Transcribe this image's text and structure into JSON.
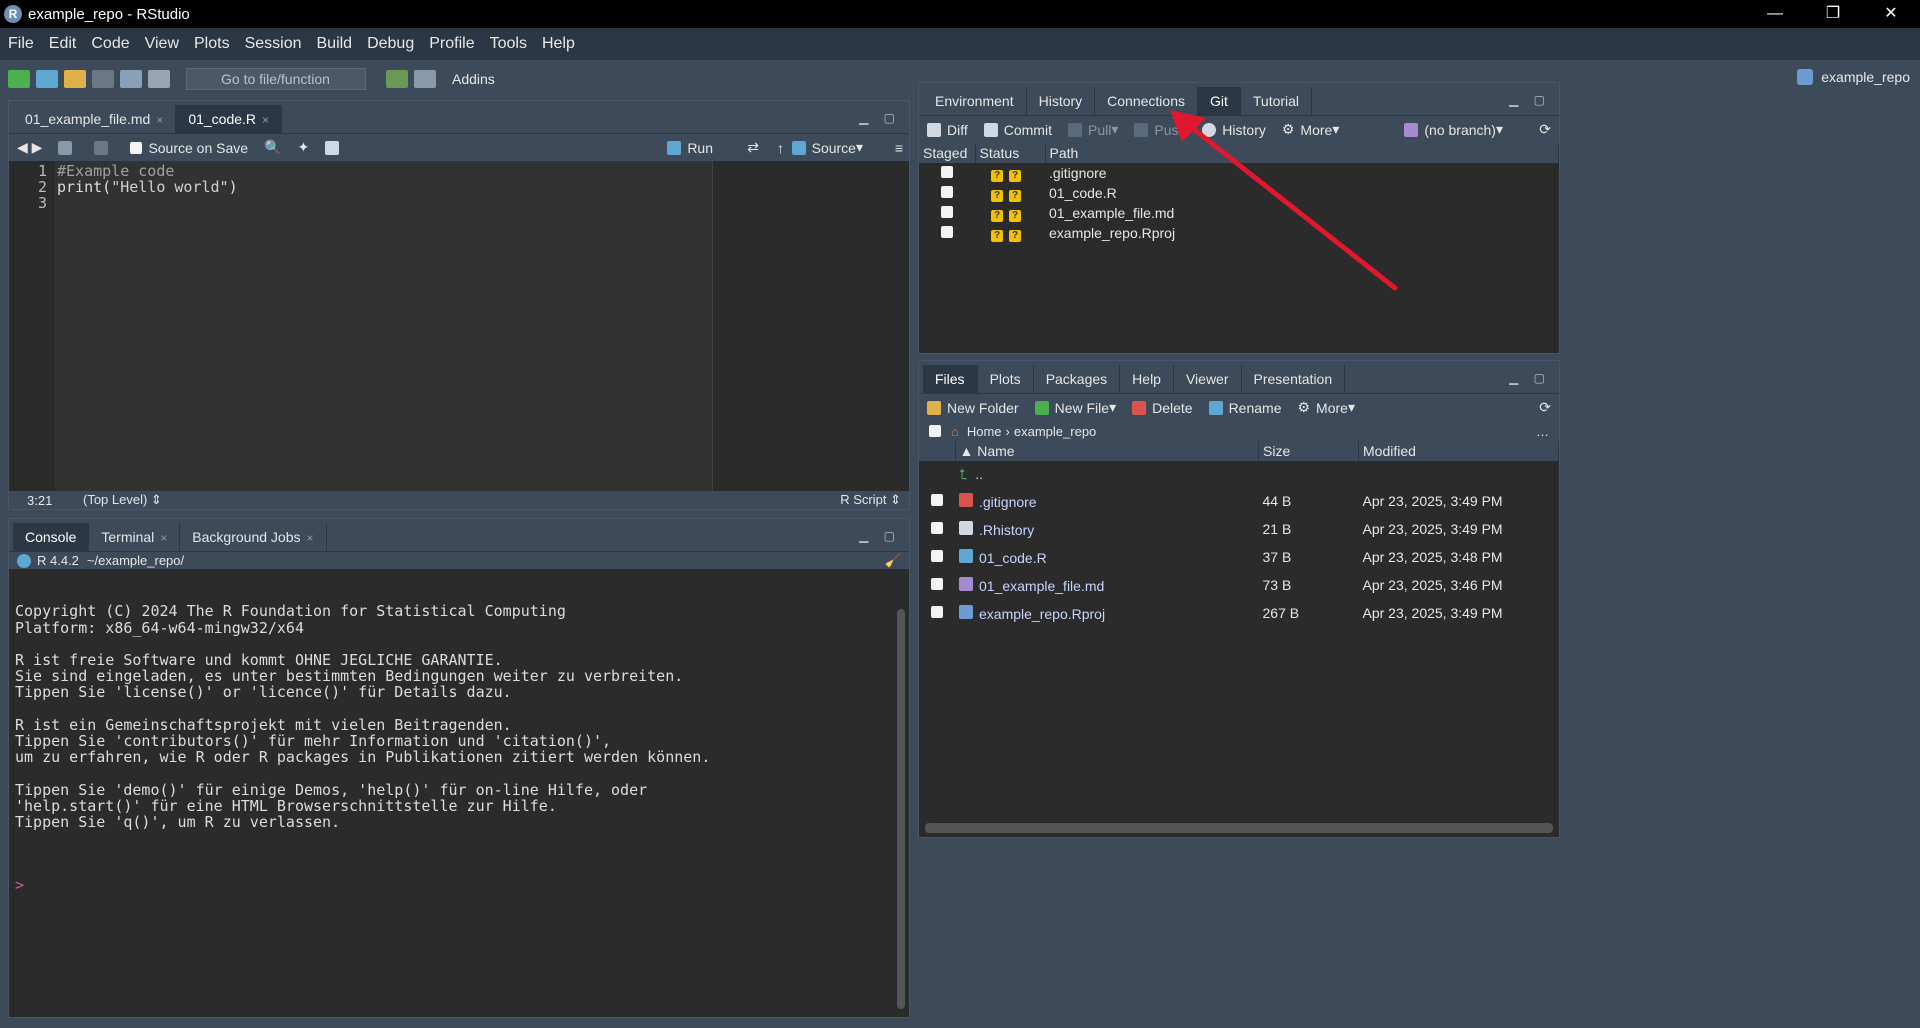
{
  "window": {
    "title": "example_repo - RStudio",
    "controls": [
      "—",
      "❐",
      "✕"
    ]
  },
  "menu": [
    "File",
    "Edit",
    "Code",
    "View",
    "Plots",
    "Session",
    "Build",
    "Debug",
    "Profile",
    "Tools",
    "Help"
  ],
  "toolbar": {
    "goto_placeholder": "Go to file/function",
    "addins": "Addins",
    "project": "example_repo"
  },
  "editor": {
    "tabs": [
      {
        "label": "01_example_file.md",
        "close": "×"
      },
      {
        "label": "01_code.R",
        "close": "×"
      }
    ],
    "source_on_save": "Source on Save",
    "run": "Run",
    "source": "Source",
    "lines": [
      "1",
      "2",
      "3"
    ],
    "code": {
      "line1": "",
      "line2": "#Example code",
      "line3_fn": "print",
      "line3_open": "(",
      "line3_str": "\"Hello world\"",
      "line3_close": ")"
    },
    "status": {
      "position": "3:21",
      "scope": "(Top Level)",
      "filetype": "R Script"
    }
  },
  "console": {
    "tabs": [
      {
        "label": "Console",
        "close": ""
      },
      {
        "label": "Terminal",
        "close": "×"
      },
      {
        "label": "Background Jobs",
        "close": "×"
      }
    ],
    "r_version": "R 4.4.2",
    "wd": "~/example_repo/",
    "output": "Copyright (C) 2024 The R Foundation for Statistical Computing\nPlatform: x86_64-w64-mingw32/x64\n\nR ist freie Software und kommt OHNE JEGLICHE GARANTIE.\nSie sind eingeladen, es unter bestimmten Bedingungen weiter zu verbreiten.\nTippen Sie 'license()' or 'licence()' für Details dazu.\n\nR ist ein Gemeinschaftsprojekt mit vielen Beitragenden.\nTippen Sie 'contributors()' für mehr Information und 'citation()',\num zu erfahren, wie R oder R packages in Publikationen zitiert werden können.\n\nTippen Sie 'demo()' für einige Demos, 'help()' für on-line Hilfe, oder\n'help.start()' für eine HTML Browserschnittstelle zur Hilfe.\nTippen Sie 'q()', um R zu verlassen.",
    "prompt": ">"
  },
  "git": {
    "tabs": [
      "Environment",
      "History",
      "Connections",
      "Git",
      "Tutorial"
    ],
    "buttons": {
      "diff": "Diff",
      "commit": "Commit",
      "pull": "Pull",
      "push": "Push",
      "history": "History",
      "more": "More",
      "branch": "(no branch)"
    },
    "columns": [
      "Staged",
      "Status",
      "Path"
    ],
    "rows": [
      {
        "path": ".gitignore",
        "status1": "?",
        "status2": "?"
      },
      {
        "path": "01_code.R",
        "status1": "?",
        "status2": "?"
      },
      {
        "path": "01_example_file.md",
        "status1": "?",
        "status2": "?"
      },
      {
        "path": "example_repo.Rproj",
        "status1": "?",
        "status2": "?"
      }
    ]
  },
  "files": {
    "tabs": [
      "Files",
      "Plots",
      "Packages",
      "Help",
      "Viewer",
      "Presentation"
    ],
    "buttons": {
      "new_folder": "New Folder",
      "new_file": "New File",
      "delete": "Delete",
      "rename": "Rename",
      "more": "More"
    },
    "breadcrumb": {
      "home": "Home",
      "sep": "›",
      "folder": "example_repo"
    },
    "columns": [
      "Name",
      "Size",
      "Modified"
    ],
    "parent": "..",
    "rows": [
      {
        "name": ".gitignore",
        "size": "44 B",
        "modified": "Apr 23, 2025, 3:49 PM"
      },
      {
        "name": ".Rhistory",
        "size": "21 B",
        "modified": "Apr 23, 2025, 3:49 PM"
      },
      {
        "name": "01_code.R",
        "size": "37 B",
        "modified": "Apr 23, 2025, 3:48 PM"
      },
      {
        "name": "01_example_file.md",
        "size": "73 B",
        "modified": "Apr 23, 2025, 3:46 PM"
      },
      {
        "name": "example_repo.Rproj",
        "size": "267 B",
        "modified": "Apr 23, 2025, 3:49 PM"
      }
    ]
  },
  "colors": {
    "arrow": "#e0182d",
    "accent": "#3c4a59"
  }
}
